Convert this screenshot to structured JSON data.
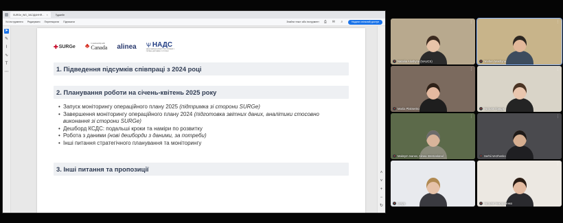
{
  "browser": {
    "tabs": [
      {
        "label": "SURGe_WG_ЗАСІДАННЯ…",
        "active": true
      },
      {
        "label": "Гуджейн",
        "active": false
      }
    ],
    "toolbar": {
      "items_left": [
        "Усі інструменти",
        "Редагувати",
        "Перетворити",
        "Підписати"
      ],
      "search_hint": "Знайти текст або інструмент",
      "share_label": "Надати спільний доступ",
      "record_label": "Підписатися"
    }
  },
  "slide": {
    "logos": {
      "surge": "SURGe",
      "canada_small": "In partnership with",
      "canada": "Canada",
      "alinea": "alinea",
      "nads": "НАДС",
      "nads_sub": "НАЦІОНАЛЬНЕ АГЕНТСТВО УКРАЇНИ З ПИТАНЬ ДЕРЖАВНОЇ СЛУЖБИ"
    },
    "section1": "1. Підведення підсумків співпраці з 2024 році",
    "section2": "2. Планування роботи на січень-квітень 2025 року",
    "bullets": [
      {
        "text": "Запуск моніторингу операційного плану 2025 ",
        "note": "(підтримка зі сторони SURGe)"
      },
      {
        "text": "Завершення моніторингу операційного плану 2024 ",
        "note": "(підготовка звітних даних, аналітики стосовно виконання зі сторони SURGe)"
      },
      {
        "text": "Дешборд КСДС: подальші кроки та наміри по розвитку",
        "note": ""
      },
      {
        "text": "Робота з даними ",
        "note": "(нові дешборди з даними, за потреби)"
      },
      {
        "text": "Інші питання стратегічного планування та моніторингу",
        "note": ""
      }
    ],
    "section3": "3. Інші питання та пропозиції"
  },
  "participants": [
    {
      "name": "Nataliia Alushyna (NAUCS)",
      "speaking": false,
      "bg": "#b8a98e",
      "skin": "#e8c3a8",
      "clothes": "#2b2b2b",
      "hair": "#3b2a1f"
    },
    {
      "name": "Yevhen Mashyna",
      "speaking": true,
      "bg": "#c8b48a",
      "skin": "#e2b89a",
      "clothes": "#3d4c5e",
      "hair": "#2c2620"
    },
    {
      "name": "Mariia Plaksenko",
      "speaking": false,
      "bg": "#7b6a5e",
      "skin": "#e4b9a0",
      "clothes": "#1e1e1e",
      "hair": "#2e2118"
    },
    {
      "name": "Наталія Грицак",
      "speaking": false,
      "bg": "#d9d4c8",
      "skin": "#e9c6ae",
      "clothes": "#242424",
      "hair": "#4a3424"
    },
    {
      "name": "Maksym Ivanov, Alinea International",
      "speaking": false,
      "bg": "#5c6a4a",
      "skin": "#d8b49a",
      "clothes": "#8a8a7a",
      "hair": "#6b6b6b"
    },
    {
      "name": "Serhii Verzhenko",
      "speaking": false,
      "bg": "#4a4a4e",
      "skin": "#d6ae90",
      "clothes": "#1f1f22",
      "hair": "#1e1a18"
    },
    {
      "name": "Lesya",
      "speaking": false,
      "bg": "#e8eaee",
      "skin": "#e6c2a8",
      "clothes": "#3a3a40",
      "hair": "#b08a52"
    },
    {
      "name": "Наталія Никорученко",
      "speaking": false,
      "bg": "#ece8e2",
      "skin": "#e4bca2",
      "clothes": "#2a2a2e",
      "hair": "#2a1c14"
    }
  ]
}
